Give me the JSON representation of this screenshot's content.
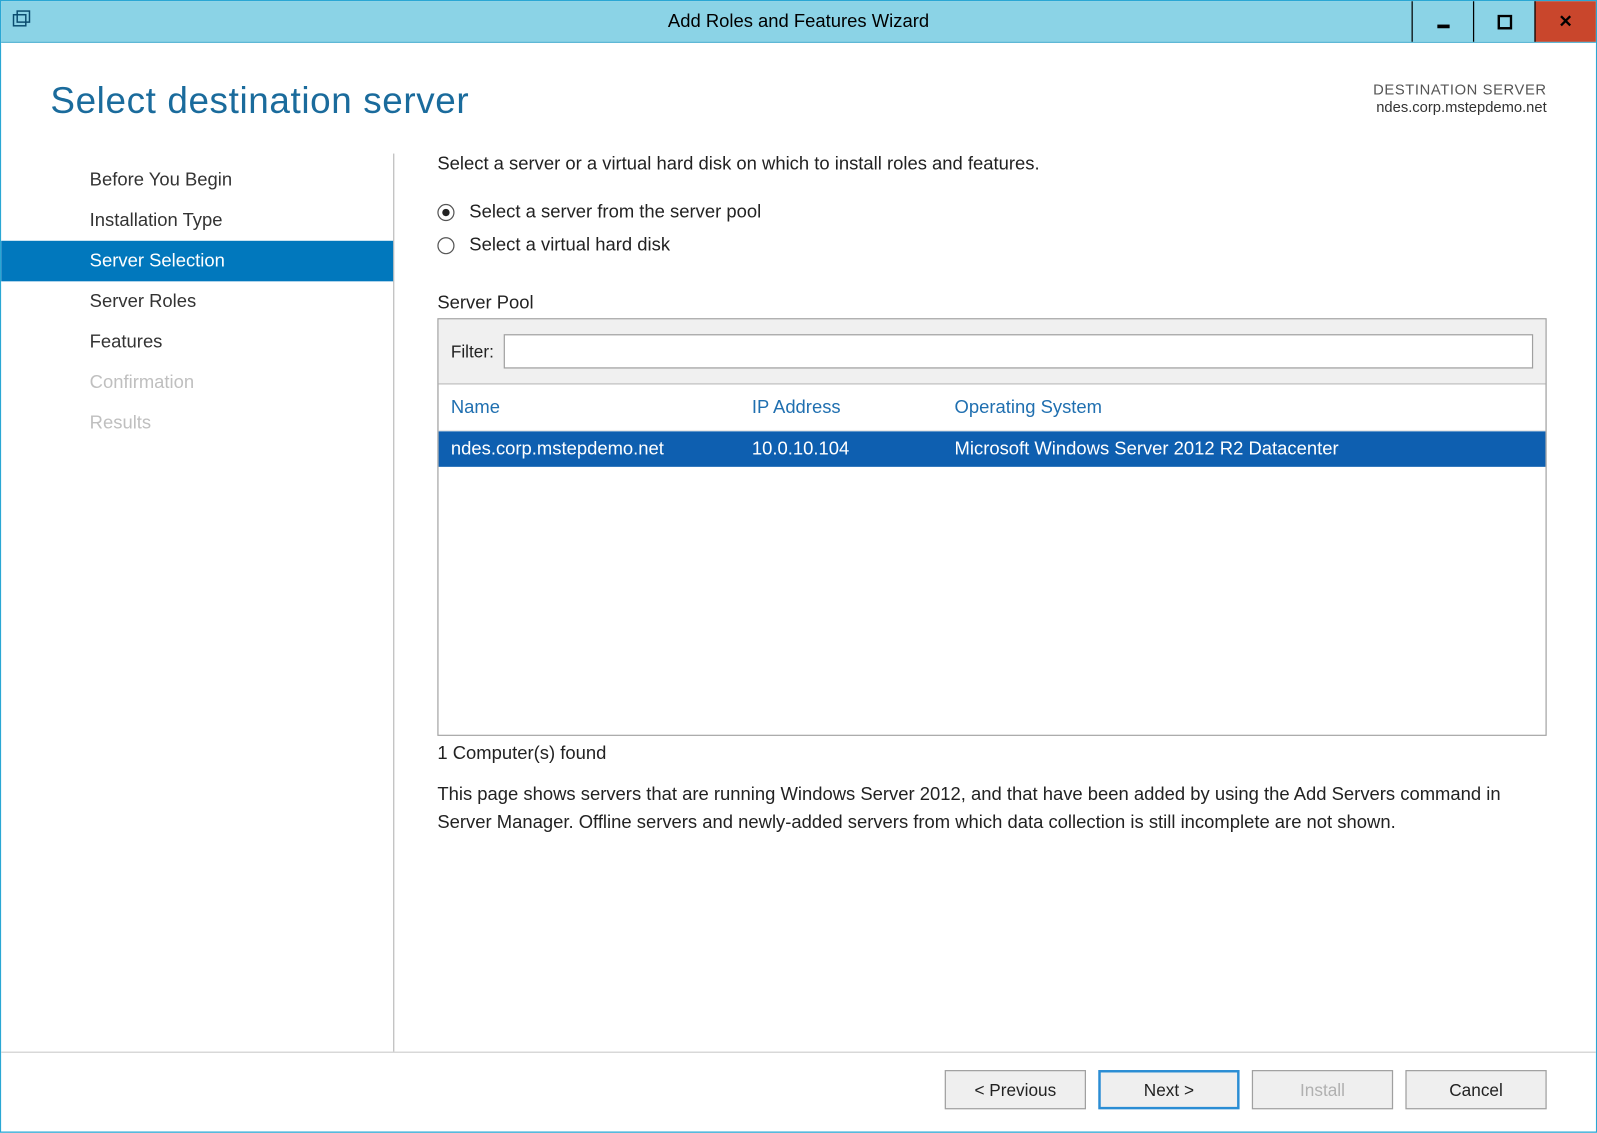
{
  "window": {
    "title": "Add Roles and Features Wizard"
  },
  "header": {
    "page_title": "Select destination server",
    "dest_label": "DESTINATION SERVER",
    "dest_value": "ndes.corp.mstepdemo.net"
  },
  "sidebar": {
    "items": [
      {
        "label": "Before You Begin",
        "state": "normal"
      },
      {
        "label": "Installation Type",
        "state": "normal"
      },
      {
        "label": "Server Selection",
        "state": "selected"
      },
      {
        "label": "Server Roles",
        "state": "normal"
      },
      {
        "label": "Features",
        "state": "normal"
      },
      {
        "label": "Confirmation",
        "state": "disabled"
      },
      {
        "label": "Results",
        "state": "disabled"
      }
    ]
  },
  "main": {
    "instruction": "Select a server or a virtual hard disk on which to install roles and features.",
    "radios": {
      "pool": "Select a server from the server pool",
      "vhd": "Select a virtual hard disk"
    },
    "pool_label": "Server Pool",
    "filter_label": "Filter:",
    "filter_value": "",
    "columns": {
      "name": "Name",
      "ip": "IP Address",
      "os": "Operating System"
    },
    "rows": [
      {
        "name": "ndes.corp.mstepdemo.net",
        "ip": "10.0.10.104",
        "os": "Microsoft Windows Server 2012 R2 Datacenter"
      }
    ],
    "found": "1 Computer(s) found",
    "explain": "This page shows servers that are running Windows Server 2012, and that have been added by using the Add Servers command in Server Manager. Offline servers and newly-added servers from which data collection is still incomplete are not shown."
  },
  "footer": {
    "previous": "< Previous",
    "next": "Next >",
    "install": "Install",
    "cancel": "Cancel"
  }
}
